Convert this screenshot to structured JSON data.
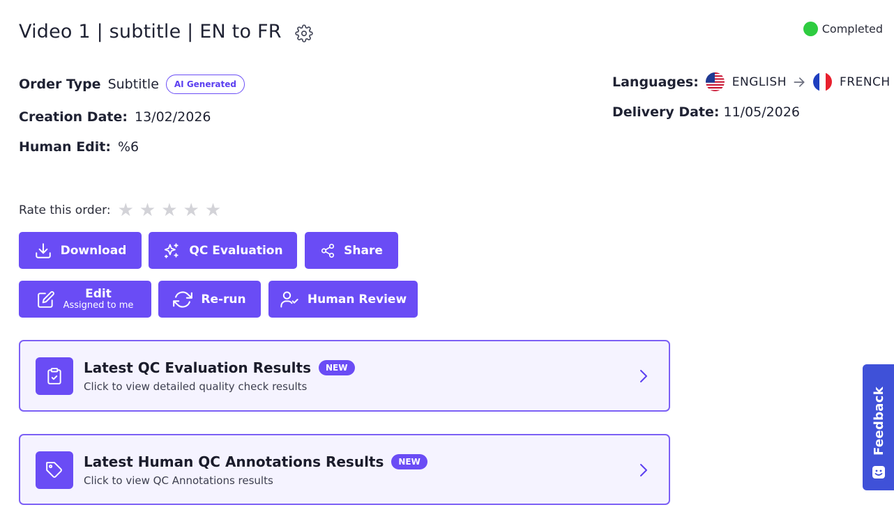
{
  "header": {
    "title": "Video 1 | subtitle | EN to FR",
    "status": "Completed",
    "status_color": "#2ecc40"
  },
  "meta": {
    "order_type_label": "Order Type",
    "order_type_value": "Subtitle",
    "ai_badge": "AI Generated",
    "creation_label": "Creation Date:",
    "creation_value": "13/02/2026",
    "human_edit_label": "Human Edit:",
    "human_edit_value": "%6",
    "languages_label": "Languages:",
    "source_lang": "ENGLISH",
    "target_lang": "FRENCH",
    "delivery_label": "Delivery Date:",
    "delivery_value": "11/05/2026"
  },
  "rating": {
    "label": "Rate this order:",
    "stars": [
      "★",
      "★",
      "★",
      "★",
      "★"
    ],
    "value": 0,
    "max": 5
  },
  "actions": {
    "download": "Download",
    "qc_evaluation": "QC Evaluation",
    "share": "Share",
    "edit": "Edit",
    "edit_sub": "Assigned to me",
    "rerun": "Re-run",
    "human_review": "Human Review"
  },
  "cards": {
    "qc": {
      "title": "Latest QC Evaluation Results",
      "badge": "NEW",
      "subtitle": "Click to view detailed quality check results"
    },
    "human_qc": {
      "title": "Latest Human QC Annotations Results",
      "badge": "NEW",
      "subtitle": "Click to view QC Annotations results"
    }
  },
  "feedback": {
    "label": "Feedback"
  },
  "colors": {
    "accent": "#6a4cf5",
    "feedback": "#3f51d8",
    "card_bg": "#f5f3ff"
  }
}
